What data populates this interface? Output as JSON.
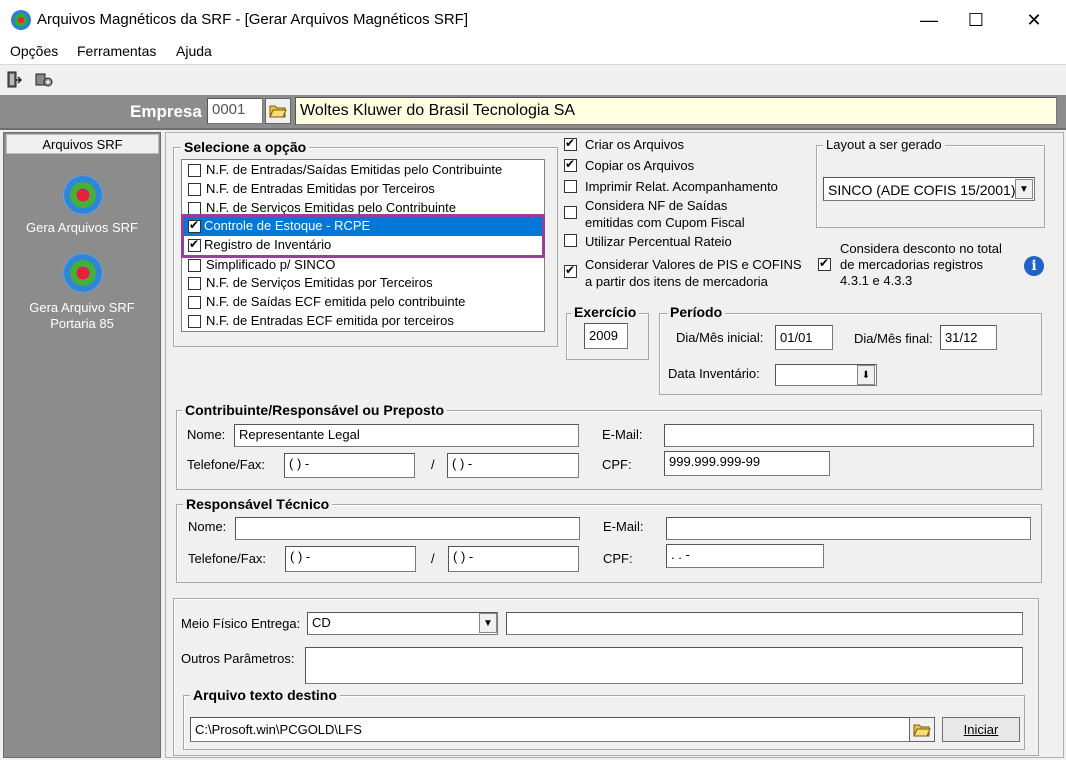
{
  "window": {
    "title": "Arquivos Magnéticos da SRF - [Gerar Arquivos Magnéticos SRF]",
    "minimize": "—",
    "maximize": "☐",
    "close": "✕"
  },
  "menu": [
    {
      "label": "Opções"
    },
    {
      "label": "Ferramentas"
    },
    {
      "label": "Ajuda"
    }
  ],
  "empresa": {
    "label": "Empresa",
    "code": "0001",
    "name": "Woltes Kluwer do Brasil Tecnologia SA"
  },
  "sidebar": {
    "header": "Arquivos SRF",
    "items": [
      {
        "label": "Gera Arquivos SRF"
      },
      {
        "label": "Gera Arquivo SRF\nPortaria 85"
      }
    ]
  },
  "selecione": {
    "title": "Selecione a opção",
    "options": [
      {
        "label": "N.F. de Entradas/Saídas Emitidas pelo Contribuinte",
        "checked": false
      },
      {
        "label": "N.F. de Entradas Emitidas por Terceiros",
        "checked": false
      },
      {
        "label": "N.F. de Serviços Emitidas pelo Contribuinte",
        "checked": false
      },
      {
        "label": "Controle de Estoque - RCPE",
        "checked": true
      },
      {
        "label": "Registro de Inventário",
        "checked": true
      },
      {
        "label": "Simplificado p/ SINCO",
        "checked": false
      },
      {
        "label": "N.F. de Serviços Emitidas por Terceiros",
        "checked": false
      },
      {
        "label": "N.F. de Saídas ECF emitida pelo contribuinte",
        "checked": false
      },
      {
        "label": "N.F. de Entradas ECF emitida por terceiros",
        "checked": false
      }
    ]
  },
  "flags": [
    {
      "label": "Criar os Arquivos",
      "checked": true
    },
    {
      "label": "Copiar os Arquivos",
      "checked": true
    },
    {
      "label": "Imprimir Relat. Acompanhamento",
      "checked": false
    },
    {
      "label": "Considera NF de Saídas",
      "label2": "emitidas com Cupom Fiscal",
      "checked": false
    },
    {
      "label": "Utilizar Percentual Rateio",
      "checked": false
    },
    {
      "label": "Considerar Valores de PIS e COFINS",
      "label2": "a partir dos itens de mercadoria",
      "checked": true
    }
  ],
  "layout": {
    "title": "Layout a ser gerado",
    "value": "SINCO (ADE COFIS 15/2001)"
  },
  "desconto": {
    "label": "Considera desconto no total",
    "label2": "de mercadorias registros",
    "label3": "4.3.1 e 4.3.3",
    "checked": true
  },
  "exercicio": {
    "title": "Exercício",
    "value": "2009"
  },
  "periodo": {
    "title": "Período",
    "inicial_label": "Dia/Mês inicial:",
    "inicial": "01/01",
    "final_label": "Dia/Mês final:",
    "final": "31/12",
    "inventario_label": "Data Inventário:",
    "inventario": ""
  },
  "contribuinte": {
    "title": "Contribuinte/Responsável ou Preposto",
    "nome_label": "Nome:",
    "nome": "Representante Legal",
    "email_label": "E-Mail:",
    "email": "",
    "telefone_label": "Telefone/Fax:",
    "telefone": "(   )      -",
    "fax": "(   )      -",
    "slash": "/",
    "cpf_label": "CPF:",
    "cpf": "999.999.999-99"
  },
  "tecnico": {
    "title": "Responsável Técnico",
    "nome_label": "Nome:",
    "nome": "",
    "email_label": "E-Mail:",
    "email": "",
    "telefone_label": "Telefone/Fax:",
    "telefone": "(   )      -",
    "fax": "(   )      -",
    "slash": "/",
    "cpf_label": "CPF:",
    "cpf": "   .    .    -"
  },
  "entrega": {
    "meio_label": "Meio Físico Entrega:",
    "meio": "CD",
    "meio_extra": "",
    "outros_label": "Outros Parâmetros:",
    "outros": ""
  },
  "destino": {
    "title": "Arquivo texto destino",
    "path": "C:\\Prosoft.win\\PCGOLD\\LFS",
    "iniciar": "Iniciar"
  },
  "colors": {
    "selection": "#0078d7",
    "highlight_border": "#9b3d9b",
    "empresa_name_bg": "#ffffe1",
    "sidebar_bg": "#8c8c8c"
  }
}
